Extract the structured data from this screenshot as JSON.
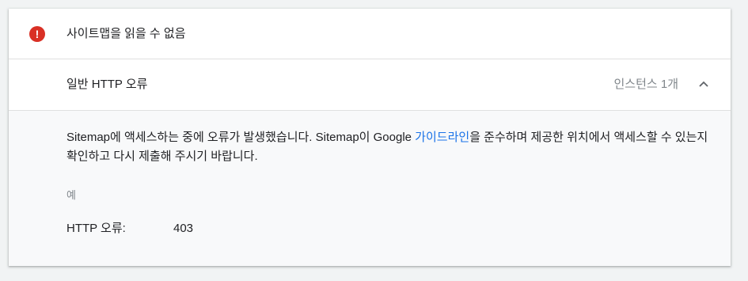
{
  "header": {
    "icon": "error-icon",
    "status_color": "#d93025",
    "title": "사이트맵을 읽을 수 없음"
  },
  "issue": {
    "title": "일반 HTTP 오류",
    "instances": "인스턴스 1개",
    "collapse_icon": "chevron-up-icon"
  },
  "detail": {
    "desc_before": "Sitemap에 액세스하는 중에 오류가 발생했습니다. Sitemap이 Google ",
    "link_text": "가이드라인",
    "desc_after": "을 준수하며 제공한 위치에서 액세스할 수 있는지 확인하고 다시 제출해 주시기 바랍니다.",
    "example_label": "예",
    "http_label": "HTTP 오류:",
    "http_value": "403",
    "link_color": "#1a73e8"
  }
}
